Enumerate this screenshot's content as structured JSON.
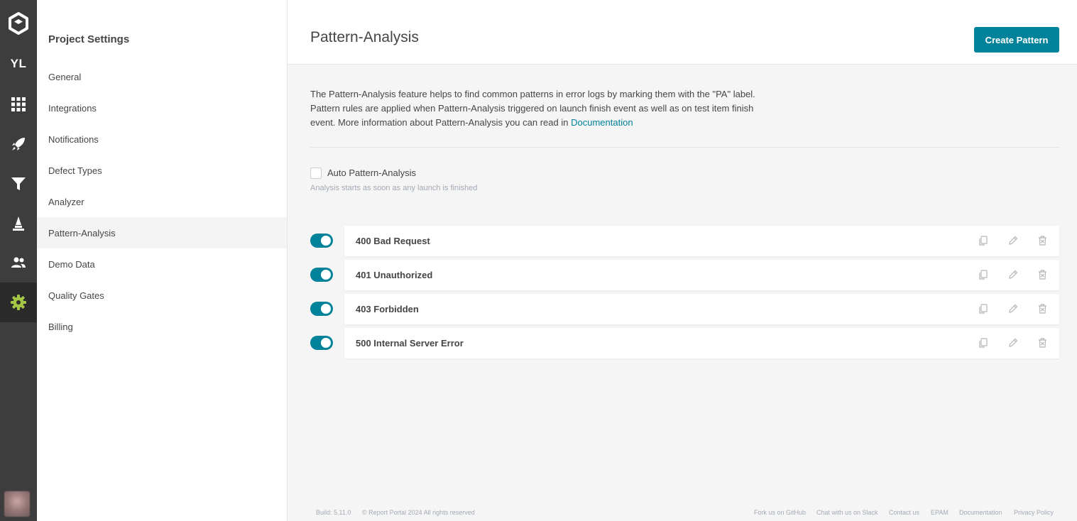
{
  "rail": {
    "logo_icon": "report-portal-logo-icon",
    "project_initials": "YL",
    "items": [
      {
        "icon": "dashboard-grid-icon"
      },
      {
        "icon": "launches-rocket-icon"
      },
      {
        "icon": "filters-funnel-icon"
      },
      {
        "icon": "debug-icon"
      },
      {
        "icon": "members-icon"
      },
      {
        "icon": "settings-gear-icon"
      }
    ],
    "active_color": "#a3c644"
  },
  "sidebar": {
    "title": "Project Settings",
    "items": [
      {
        "label": "General"
      },
      {
        "label": "Integrations"
      },
      {
        "label": "Notifications"
      },
      {
        "label": "Defect Types"
      },
      {
        "label": "Analyzer"
      },
      {
        "label": "Pattern-Analysis"
      },
      {
        "label": "Demo Data"
      },
      {
        "label": "Quality Gates"
      },
      {
        "label": "Billing"
      }
    ],
    "active": "Pattern-Analysis"
  },
  "header": {
    "title": "Pattern-Analysis",
    "create_button": "Create Pattern"
  },
  "description": {
    "line1": "The Pattern-Analysis feature helps to find common patterns in error logs by marking them with the \"PA\" label.",
    "line2": "Pattern rules are applied when Pattern-Analysis triggered on launch finish event as well as on test item finish",
    "line3": "event. More information about Pattern-Analysis you can read in",
    "link": "Documentation"
  },
  "auto_analysis": {
    "label": "Auto Pattern-Analysis",
    "checked": false,
    "hint": "Analysis starts as soon as any launch is finished"
  },
  "patterns": [
    {
      "name": "400 Bad Request",
      "enabled": true
    },
    {
      "name": "401 Unauthorized",
      "enabled": true
    },
    {
      "name": "403 Forbidden",
      "enabled": true
    },
    {
      "name": "500 Internal Server Error",
      "enabled": true
    }
  ],
  "footer": {
    "build": "Build: 5.11.0",
    "copyright": "© Report Portal 2024 All rights reserved",
    "links": [
      "Fork us on GitHub",
      "Chat with us on Slack",
      "Contact us",
      "EPAM",
      "Documentation",
      "Privacy Policy"
    ]
  },
  "colors": {
    "accent": "#00829b",
    "rail_bg": "#3d3d3d",
    "text": "#464547"
  }
}
